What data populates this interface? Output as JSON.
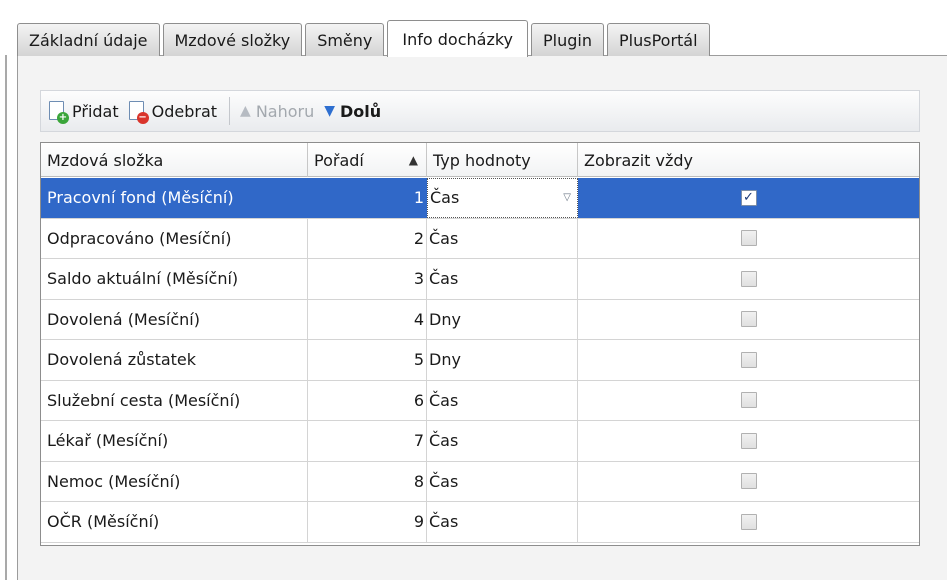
{
  "tabs": [
    {
      "label": "Základní údaje",
      "active": false
    },
    {
      "label": "Mzdové složky",
      "active": false
    },
    {
      "label": "Směny",
      "active": false
    },
    {
      "label": "Info docházky",
      "active": true
    },
    {
      "label": "Plugin",
      "active": false
    },
    {
      "label": "PlusPortál",
      "active": false
    }
  ],
  "toolbar": {
    "add_label": "Přidat",
    "remove_label": "Odebrat",
    "up_label": "Nahoru",
    "down_label": "Dolů"
  },
  "icons": {
    "add": "add-document-icon",
    "remove": "remove-document-icon",
    "up": "arrow-up-icon",
    "down": "arrow-down-icon",
    "sort": "sort-ascending-icon",
    "dropdown": "chevron-down-icon",
    "check": "checkmark-icon"
  },
  "colors": {
    "selection": "#3068c8",
    "down_arrow": "#2e6fd0",
    "add_badge": "#3aa53a",
    "remove_badge": "#d9342b"
  },
  "grid": {
    "columns": [
      "Mzdová složka",
      "Pořadí",
      "Typ hodnoty",
      "Zobrazit vždy"
    ],
    "sort_indicator": "▲",
    "dropdown_glyph": "▽",
    "check_glyph": "✓",
    "rows": [
      {
        "name": "Pracovní fond (Měsíční)",
        "order": "1",
        "type": "Čas",
        "show_always": true,
        "selected": true
      },
      {
        "name": "Odpracováno (Mesíční)",
        "order": "2",
        "type": "Čas",
        "show_always": false,
        "selected": false
      },
      {
        "name": "Saldo aktuální (Měsíční)",
        "order": "3",
        "type": "Čas",
        "show_always": false,
        "selected": false
      },
      {
        "name": "Dovolená (Mesíční)",
        "order": "4",
        "type": "Dny",
        "show_always": false,
        "selected": false
      },
      {
        "name": "Dovolená zůstatek",
        "order": "5",
        "type": "Dny",
        "show_always": false,
        "selected": false
      },
      {
        "name": "Služební cesta (Mesíční)",
        "order": "6",
        "type": "Čas",
        "show_always": false,
        "selected": false
      },
      {
        "name": "Lékař (Mesíční)",
        "order": "7",
        "type": "Čas",
        "show_always": false,
        "selected": false
      },
      {
        "name": "Nemoc (Mesíční)",
        "order": "8",
        "type": "Čas",
        "show_always": false,
        "selected": false
      },
      {
        "name": "OČR (Měsíční)",
        "order": "9",
        "type": "Čas",
        "show_always": false,
        "selected": false
      }
    ]
  }
}
